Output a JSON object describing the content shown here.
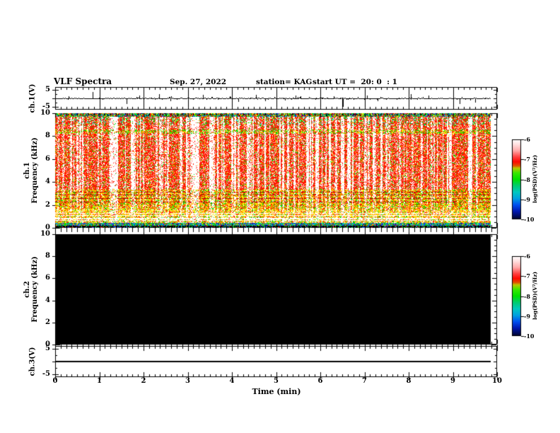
{
  "header": {
    "title": "VLF Spectra",
    "date": "Sep. 27, 2022",
    "station": "station= KAG",
    "start_ut": "start UT =  20: 0  : 1"
  },
  "xaxis": {
    "label": "Time (min)",
    "tick_labels": [
      "0",
      "1",
      "2",
      "3",
      "4",
      "5",
      "6",
      "7",
      "8",
      "9",
      "10"
    ],
    "min": 0,
    "max": 10,
    "minor_step": 0.125,
    "data_end": 9.85
  },
  "colorbar": {
    "label": "log(PSD)(V²/Hz)",
    "tick_labels": [
      "-6",
      "-7",
      "-8",
      "-9",
      "-10"
    ],
    "gradient": [
      [
        0,
        "#ffffff"
      ],
      [
        0.06,
        "#ffe2e2"
      ],
      [
        0.14,
        "#ffaaaa"
      ],
      [
        0.22,
        "#ff4040"
      ],
      [
        0.28,
        "#ff0800"
      ],
      [
        0.33,
        "#e05000"
      ],
      [
        0.36,
        "#b8c800"
      ],
      [
        0.42,
        "#38e800"
      ],
      [
        0.5,
        "#00e000"
      ],
      [
        0.58,
        "#00cc70"
      ],
      [
        0.66,
        "#00c8c0"
      ],
      [
        0.74,
        "#00a0e0"
      ],
      [
        0.82,
        "#0050f0"
      ],
      [
        0.9,
        "#0018b0"
      ],
      [
        1,
        "#000428"
      ]
    ]
  },
  "chart_data": {
    "type": "heatmap",
    "title": "VLF Spectra",
    "panels": [
      {
        "id": "ch1_waveform",
        "type": "line",
        "ylabel": "ch.1(V)",
        "ylim": [
          -5,
          5
        ],
        "ytick_labels": [
          "5",
          "-5"
        ],
        "baseline_v": 0,
        "noise_v": 0.5,
        "spikes": [
          {
            "t": 0.3,
            "v": 1.3
          },
          {
            "t": 0.85,
            "v": 3.9
          },
          {
            "t": 1.62,
            "v": -3.3
          },
          {
            "t": 1.9,
            "v": 1.6
          },
          {
            "t": 2.35,
            "v": 2.3
          },
          {
            "t": 2.6,
            "v": -1.8
          },
          {
            "t": 3.35,
            "v": 2.1
          },
          {
            "t": 3.95,
            "v": 1.4
          },
          {
            "t": 4.15,
            "v": -2.0
          },
          {
            "t": 4.55,
            "v": 1.9
          },
          {
            "t": 4.75,
            "v": -1.6
          },
          {
            "t": 5.2,
            "v": -1.3
          },
          {
            "t": 5.55,
            "v": 1.2
          },
          {
            "t": 6.3,
            "v": 1.4
          },
          {
            "t": 6.5,
            "v": -5.0,
            "w": 2
          },
          {
            "t": 7.05,
            "v": 1.6
          },
          {
            "t": 7.3,
            "v": -1.5
          },
          {
            "t": 8.05,
            "v": 2.7
          },
          {
            "t": 8.45,
            "v": 1.5
          },
          {
            "t": 9.15,
            "v": -3.2
          },
          {
            "t": 9.5,
            "v": -2.4
          }
        ]
      },
      {
        "id": "ch1_spectrogram",
        "type": "heatmap",
        "ylabel_line1": "ch.1",
        "ylabel_line2": "Frequency (kHz)",
        "ylim": [
          0,
          10
        ],
        "ytick_labels": [
          "10",
          "8",
          "6",
          "4",
          "2",
          "0"
        ],
        "data_end": 9.85,
        "palette": {
          "white": "#ffffff",
          "pink": "#ff9090",
          "red": "#ff1800",
          "dark_red": "#b40000",
          "orange": "#ff8800",
          "yellow": "#ffe800",
          "green": "#00d800",
          "cyan": "#00c8c8",
          "blue": "#2038ff",
          "navy": "#000090",
          "black": "#000000"
        },
        "bands": [
          {
            "f": [
              9.72,
              10
            ],
            "streak": 0.1,
            "weights": {
              "green": 3,
              "cyan": 2,
              "red": 3,
              "yellow": 2,
              "blue": 1,
              "black": 1,
              "navy": 1
            }
          },
          {
            "f": [
              9.0,
              9.72
            ],
            "streak": 0.9,
            "weights": {
              "red": 7,
              "white": 2,
              "green": 2,
              "yellow": 1,
              "cyan": 1
            }
          },
          {
            "f": [
              8.2,
              8.6
            ],
            "streak": 0.7,
            "weights": {
              "green": 3,
              "red": 4,
              "yellow": 3,
              "white": 1
            }
          },
          {
            "f": [
              3.3,
              9.0
            ],
            "streak": 0.95,
            "weights": {
              "red": 8,
              "white": 2,
              "yellow": 1,
              "green": 1,
              "pink": 1
            }
          },
          {
            "f": [
              1.6,
              3.3
            ],
            "streak": 0.6,
            "weights": {
              "yellow": 5,
              "red": 4,
              "green": 2,
              "white": 1,
              "orange": 1
            }
          },
          {
            "f": [
              0.95,
              1.6
            ],
            "streak": 0.5,
            "weights": {
              "yellow": 5,
              "red": 2,
              "orange": 2,
              "green": 1,
              "white": 2
            }
          },
          {
            "f": [
              0.38,
              0.95
            ],
            "streak": 0.45,
            "weights": {
              "yellow": 4,
              "orange": 2,
              "red": 2,
              "green": 2,
              "white": 3
            }
          },
          {
            "f": [
              0.16,
              0.38
            ],
            "streak": 0.15,
            "weights": {
              "green": 3,
              "cyan": 3,
              "blue": 2,
              "yellow": 1,
              "red": 1,
              "navy": 1
            }
          },
          {
            "f": [
              0,
              0.16
            ],
            "streak": 0.05,
            "weights": {
              "black": 9,
              "blue": 1,
              "green": 1,
              "red": 1,
              "cyan": 1
            }
          }
        ],
        "white_lines_f": [
          0.62,
          0.78,
          1.04,
          1.22
        ],
        "dark_lines_f": [
          2.25,
          2.55,
          2.85,
          3.1
        ]
      },
      {
        "id": "ch2_spectrogram",
        "type": "heatmap",
        "ylabel_line1": "ch.2",
        "ylabel_line2": "Frequency (kHz)",
        "ylim": [
          0,
          10
        ],
        "ytick_labels": [
          "10",
          "8",
          "6",
          "4",
          "2",
          "0"
        ],
        "fill": "#000000",
        "data_end": 9.85
      },
      {
        "id": "ch3_waveform",
        "type": "line",
        "ylabel": "ch.3(V)",
        "ylim": [
          -5,
          5
        ],
        "ytick_labels": [
          "5",
          "-5"
        ],
        "constant_v": 0,
        "data_end": 9.85
      }
    ]
  }
}
